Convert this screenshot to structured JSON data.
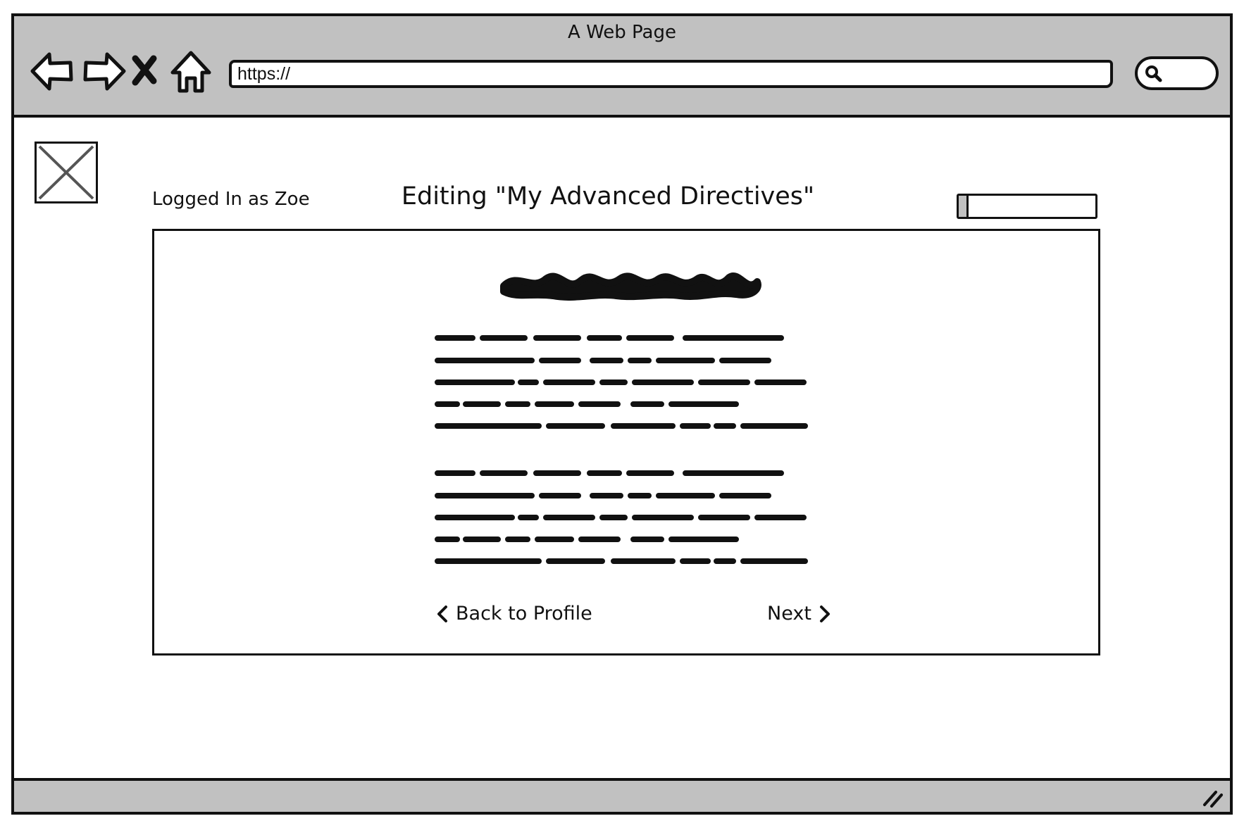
{
  "window": {
    "title": "A Web Page"
  },
  "toolbar": {
    "back_icon": "arrow-left-icon",
    "forward_icon": "arrow-right-icon",
    "stop_icon": "close-x-icon",
    "home_icon": "home-icon",
    "url_value": "https://",
    "search_icon": "search-icon"
  },
  "header": {
    "logo_icon": "image-placeholder-icon",
    "logged_in_label": "Logged In as Zoe",
    "page_title": "Editing \"My Advanced Directives\"",
    "progress_percent": 7
  },
  "panel": {
    "heading_placeholder": "scribbled-heading",
    "paragraph_placeholders": [
      "scribbled-paragraph-1",
      "scribbled-paragraph-2"
    ],
    "back_label": "Back to Profile",
    "next_label": "Next"
  },
  "colors": {
    "chrome_gray": "#c1c1c1",
    "ink": "#111111",
    "background": "#ffffff"
  }
}
